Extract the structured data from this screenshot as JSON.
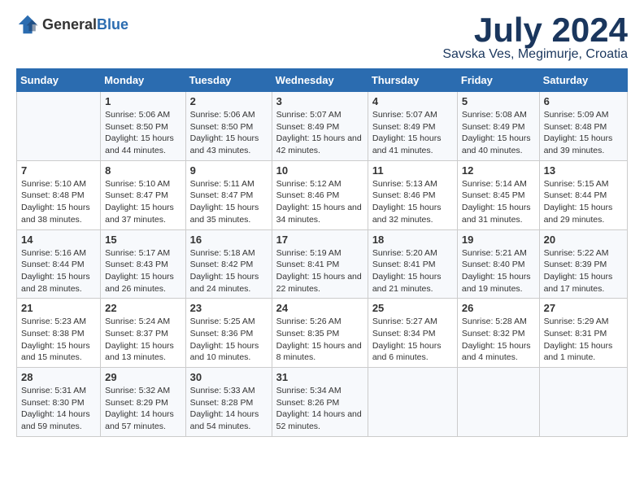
{
  "logo": {
    "general": "General",
    "blue": "Blue"
  },
  "title": {
    "month": "July 2024",
    "location": "Savska Ves, Megimurje, Croatia"
  },
  "headers": [
    "Sunday",
    "Monday",
    "Tuesday",
    "Wednesday",
    "Thursday",
    "Friday",
    "Saturday"
  ],
  "weeks": [
    [
      {
        "day": "",
        "sunrise": "",
        "sunset": "",
        "daylight": ""
      },
      {
        "day": "1",
        "sunrise": "Sunrise: 5:06 AM",
        "sunset": "Sunset: 8:50 PM",
        "daylight": "Daylight: 15 hours and 44 minutes."
      },
      {
        "day": "2",
        "sunrise": "Sunrise: 5:06 AM",
        "sunset": "Sunset: 8:50 PM",
        "daylight": "Daylight: 15 hours and 43 minutes."
      },
      {
        "day": "3",
        "sunrise": "Sunrise: 5:07 AM",
        "sunset": "Sunset: 8:49 PM",
        "daylight": "Daylight: 15 hours and 42 minutes."
      },
      {
        "day": "4",
        "sunrise": "Sunrise: 5:07 AM",
        "sunset": "Sunset: 8:49 PM",
        "daylight": "Daylight: 15 hours and 41 minutes."
      },
      {
        "day": "5",
        "sunrise": "Sunrise: 5:08 AM",
        "sunset": "Sunset: 8:49 PM",
        "daylight": "Daylight: 15 hours and 40 minutes."
      },
      {
        "day": "6",
        "sunrise": "Sunrise: 5:09 AM",
        "sunset": "Sunset: 8:48 PM",
        "daylight": "Daylight: 15 hours and 39 minutes."
      }
    ],
    [
      {
        "day": "7",
        "sunrise": "Sunrise: 5:10 AM",
        "sunset": "Sunset: 8:48 PM",
        "daylight": "Daylight: 15 hours and 38 minutes."
      },
      {
        "day": "8",
        "sunrise": "Sunrise: 5:10 AM",
        "sunset": "Sunset: 8:47 PM",
        "daylight": "Daylight: 15 hours and 37 minutes."
      },
      {
        "day": "9",
        "sunrise": "Sunrise: 5:11 AM",
        "sunset": "Sunset: 8:47 PM",
        "daylight": "Daylight: 15 hours and 35 minutes."
      },
      {
        "day": "10",
        "sunrise": "Sunrise: 5:12 AM",
        "sunset": "Sunset: 8:46 PM",
        "daylight": "Daylight: 15 hours and 34 minutes."
      },
      {
        "day": "11",
        "sunrise": "Sunrise: 5:13 AM",
        "sunset": "Sunset: 8:46 PM",
        "daylight": "Daylight: 15 hours and 32 minutes."
      },
      {
        "day": "12",
        "sunrise": "Sunrise: 5:14 AM",
        "sunset": "Sunset: 8:45 PM",
        "daylight": "Daylight: 15 hours and 31 minutes."
      },
      {
        "day": "13",
        "sunrise": "Sunrise: 5:15 AM",
        "sunset": "Sunset: 8:44 PM",
        "daylight": "Daylight: 15 hours and 29 minutes."
      }
    ],
    [
      {
        "day": "14",
        "sunrise": "Sunrise: 5:16 AM",
        "sunset": "Sunset: 8:44 PM",
        "daylight": "Daylight: 15 hours and 28 minutes."
      },
      {
        "day": "15",
        "sunrise": "Sunrise: 5:17 AM",
        "sunset": "Sunset: 8:43 PM",
        "daylight": "Daylight: 15 hours and 26 minutes."
      },
      {
        "day": "16",
        "sunrise": "Sunrise: 5:18 AM",
        "sunset": "Sunset: 8:42 PM",
        "daylight": "Daylight: 15 hours and 24 minutes."
      },
      {
        "day": "17",
        "sunrise": "Sunrise: 5:19 AM",
        "sunset": "Sunset: 8:41 PM",
        "daylight": "Daylight: 15 hours and 22 minutes."
      },
      {
        "day": "18",
        "sunrise": "Sunrise: 5:20 AM",
        "sunset": "Sunset: 8:41 PM",
        "daylight": "Daylight: 15 hours and 21 minutes."
      },
      {
        "day": "19",
        "sunrise": "Sunrise: 5:21 AM",
        "sunset": "Sunset: 8:40 PM",
        "daylight": "Daylight: 15 hours and 19 minutes."
      },
      {
        "day": "20",
        "sunrise": "Sunrise: 5:22 AM",
        "sunset": "Sunset: 8:39 PM",
        "daylight": "Daylight: 15 hours and 17 minutes."
      }
    ],
    [
      {
        "day": "21",
        "sunrise": "Sunrise: 5:23 AM",
        "sunset": "Sunset: 8:38 PM",
        "daylight": "Daylight: 15 hours and 15 minutes."
      },
      {
        "day": "22",
        "sunrise": "Sunrise: 5:24 AM",
        "sunset": "Sunset: 8:37 PM",
        "daylight": "Daylight: 15 hours and 13 minutes."
      },
      {
        "day": "23",
        "sunrise": "Sunrise: 5:25 AM",
        "sunset": "Sunset: 8:36 PM",
        "daylight": "Daylight: 15 hours and 10 minutes."
      },
      {
        "day": "24",
        "sunrise": "Sunrise: 5:26 AM",
        "sunset": "Sunset: 8:35 PM",
        "daylight": "Daylight: 15 hours and 8 minutes."
      },
      {
        "day": "25",
        "sunrise": "Sunrise: 5:27 AM",
        "sunset": "Sunset: 8:34 PM",
        "daylight": "Daylight: 15 hours and 6 minutes."
      },
      {
        "day": "26",
        "sunrise": "Sunrise: 5:28 AM",
        "sunset": "Sunset: 8:32 PM",
        "daylight": "Daylight: 15 hours and 4 minutes."
      },
      {
        "day": "27",
        "sunrise": "Sunrise: 5:29 AM",
        "sunset": "Sunset: 8:31 PM",
        "daylight": "Daylight: 15 hours and 1 minute."
      }
    ],
    [
      {
        "day": "28",
        "sunrise": "Sunrise: 5:31 AM",
        "sunset": "Sunset: 8:30 PM",
        "daylight": "Daylight: 14 hours and 59 minutes."
      },
      {
        "day": "29",
        "sunrise": "Sunrise: 5:32 AM",
        "sunset": "Sunset: 8:29 PM",
        "daylight": "Daylight: 14 hours and 57 minutes."
      },
      {
        "day": "30",
        "sunrise": "Sunrise: 5:33 AM",
        "sunset": "Sunset: 8:28 PM",
        "daylight": "Daylight: 14 hours and 54 minutes."
      },
      {
        "day": "31",
        "sunrise": "Sunrise: 5:34 AM",
        "sunset": "Sunset: 8:26 PM",
        "daylight": "Daylight: 14 hours and 52 minutes."
      },
      {
        "day": "",
        "sunrise": "",
        "sunset": "",
        "daylight": ""
      },
      {
        "day": "",
        "sunrise": "",
        "sunset": "",
        "daylight": ""
      },
      {
        "day": "",
        "sunrise": "",
        "sunset": "",
        "daylight": ""
      }
    ]
  ]
}
